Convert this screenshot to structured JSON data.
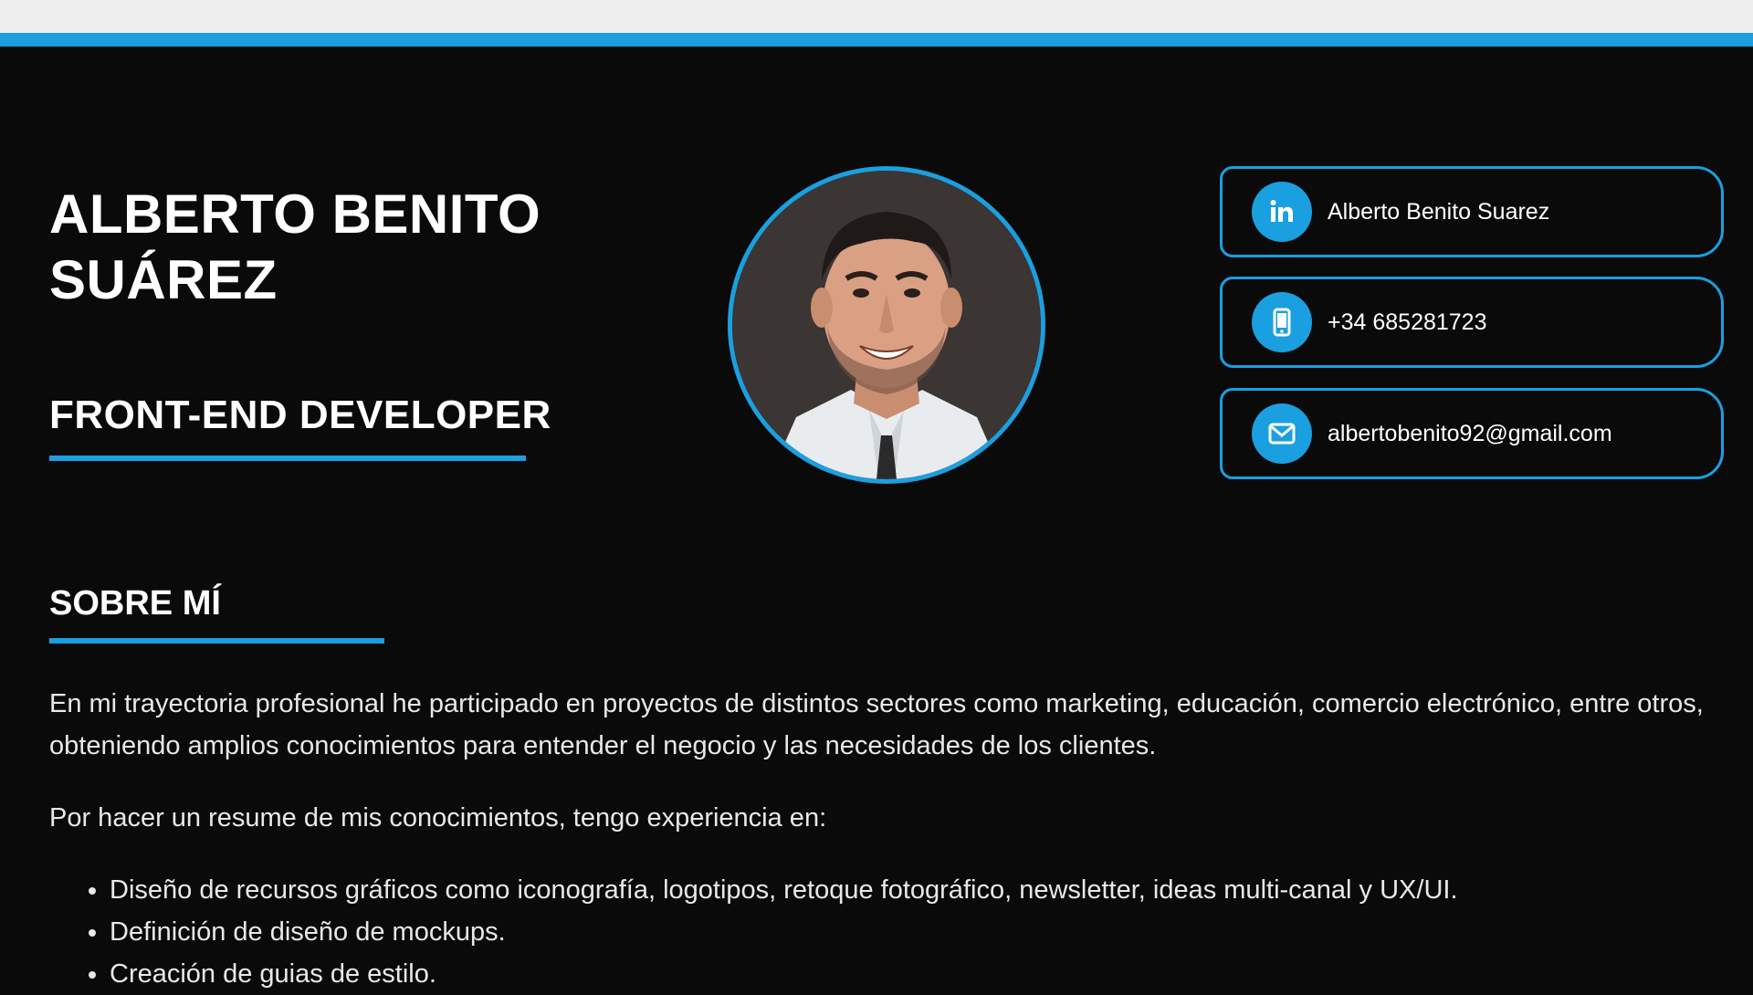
{
  "colors": {
    "accent": "#1a9fe0",
    "background": "#0a0a0a",
    "text": "#ffffff",
    "browser_bar": "#eeeeee"
  },
  "header": {
    "name_line1": "ALBERTO BENITO",
    "name_line2": "SUÁREZ",
    "role": "FRONT-END DEVELOPER",
    "avatar": "profile-photo"
  },
  "contacts": [
    {
      "icon": "linkedin-icon",
      "text": "Alberto Benito Suarez"
    },
    {
      "icon": "mobile-phone-icon",
      "text": "+34 685281723"
    },
    {
      "icon": "envelope-icon",
      "text": "albertobenito92@gmail.com"
    }
  ],
  "about": {
    "title": "SOBRE MÍ",
    "paragraph1": "En mi trayectoria profesional he participado en proyectos de distintos sectores como marketing, educación, comercio electrónico, entre otros, obteniendo amplios conocimientos para entender el negocio y las necesidades de los clientes.",
    "paragraph2": "Por hacer un resume de mis conocimientos, tengo experiencia en:",
    "skills": [
      "Diseño de recursos gráficos como iconografía, logotipos, retoque fotográfico, newsletter, ideas multi-canal y UX/UI.",
      "Definición de diseño de mockups.",
      "Creación de guias de estilo."
    ]
  }
}
